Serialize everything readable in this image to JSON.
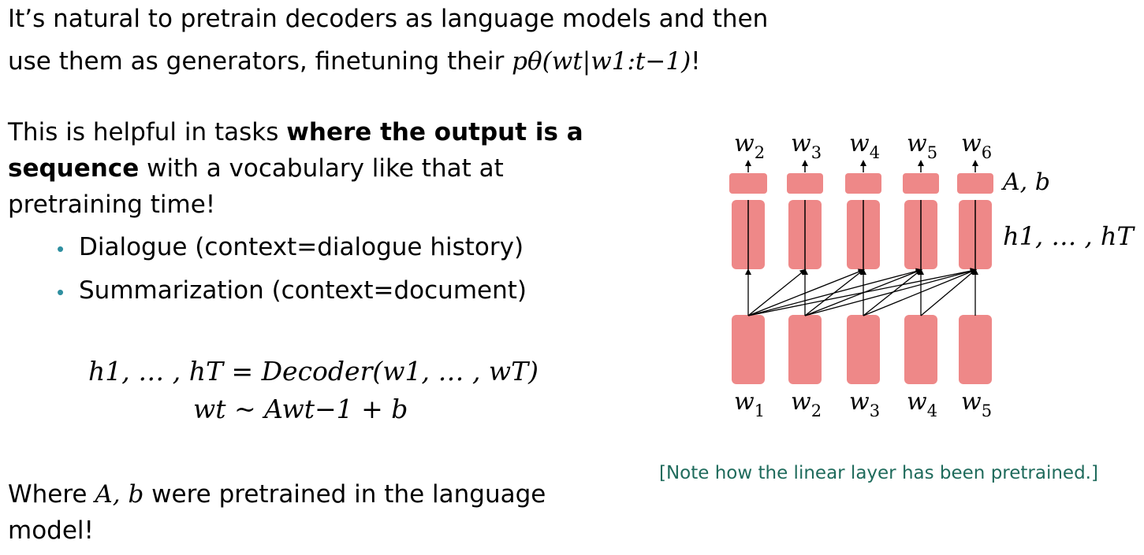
{
  "intro": {
    "line1": "It’s natural to pretrain decoders as language models and then",
    "line2_prefix": "use them as generators, finetuning their ",
    "line2_math": "pθ(wt|w1:t−1)",
    "line2_suffix": "!"
  },
  "helpful": {
    "part1": "This is helpful in tasks ",
    "bold1": "where the output is a",
    "bold2": "sequence",
    "part2": " with a vocabulary like that at",
    "line3": "pretraining time!"
  },
  "bullets": [
    {
      "text": "Dialogue (context=dialogue history)"
    },
    {
      "text": "Summarization (context=document)"
    }
  ],
  "equations": {
    "eq1": "h1, … , hT =  Decoder(w1, … , wT)",
    "eq2": "wt ~ Awt−1 + b"
  },
  "closing": {
    "prefix": "Where ",
    "math": "A, b",
    "suffix": " were pretrained in the language",
    "line2": "model!"
  },
  "diagram": {
    "outputs": [
      "w2",
      "w3",
      "w4",
      "w5",
      "w6"
    ],
    "inputs": [
      "w1",
      "w2",
      "w3",
      "w4",
      "w5"
    ],
    "linear_label": "A, b",
    "hidden_label": "h1, … , hT",
    "block_color": "#ee8888"
  },
  "note": "[Note how the linear layer has been pretrained.]",
  "colors": {
    "bullet": "#2f8fa0",
    "note": "#1f6b5c",
    "block": "#ee8888"
  }
}
